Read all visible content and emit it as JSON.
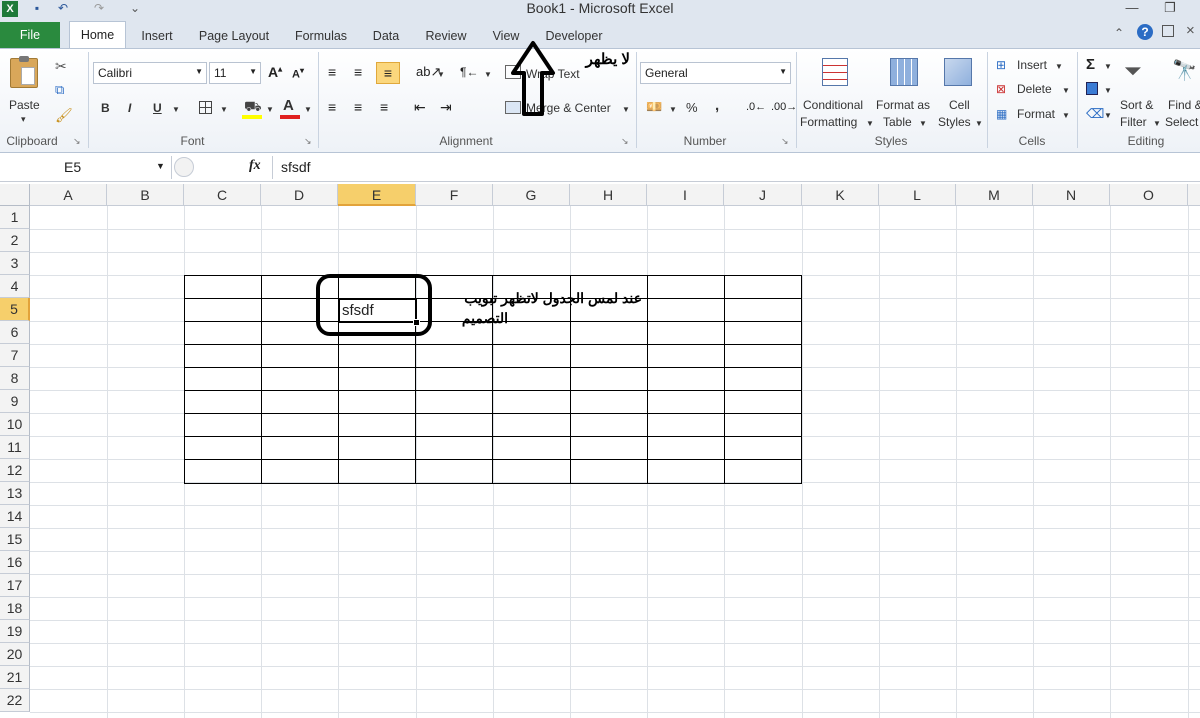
{
  "window": {
    "title": "Book1  -  Microsoft Excel"
  },
  "tabs": [
    "File",
    "Home",
    "Insert",
    "Page Layout",
    "Formulas",
    "Data",
    "Review",
    "View",
    "Developer"
  ],
  "clipboard": {
    "paste": "Paste",
    "group": "Clipboard"
  },
  "font": {
    "name": "Calibri",
    "size": "11",
    "group": "Font",
    "bold": "B",
    "italic": "I",
    "underline": "U"
  },
  "alignment": {
    "wrap_text": "Wrap Text",
    "merge_center": "Merge & Center",
    "group": "Alignment"
  },
  "number": {
    "format": "General",
    "percent": "%",
    "comma": ",",
    "group": "Number"
  },
  "styles": {
    "conditional": [
      "Conditional",
      "Formatting"
    ],
    "format_as_table": [
      "Format as",
      "Table"
    ],
    "cell_styles": [
      "Cell",
      "Styles"
    ],
    "group": "Styles"
  },
  "cells": {
    "insert": "Insert",
    "delete": "Delete",
    "format": "Format",
    "group": "Cells"
  },
  "editing": {
    "sort_filter": [
      "Sort &",
      "Filter"
    ],
    "find_select": [
      "Find &",
      "Select"
    ],
    "group": "Editing"
  },
  "formula_bar": {
    "name_box": "E5",
    "fx": "fx",
    "value": "sfsdf"
  },
  "columns": [
    "A",
    "B",
    "C",
    "D",
    "E",
    "F",
    "G",
    "H",
    "I",
    "J",
    "K",
    "L",
    "M",
    "N",
    "O"
  ],
  "rows": [
    "1",
    "2",
    "3",
    "4",
    "5",
    "6",
    "7",
    "8",
    "9",
    "10",
    "11",
    "12",
    "13",
    "14",
    "15",
    "16",
    "17",
    "18",
    "19",
    "20",
    "21",
    "22"
  ],
  "active_cell": {
    "ref": "E5",
    "value": "sfsdf"
  },
  "annotations": {
    "arrow_note": "لا يظهر",
    "table_note_line1": "عند لمس الجدول لاتظهر تبويب",
    "table_note_line2": "التصميم"
  },
  "colors": {
    "file_tab": "#2a8a3e",
    "ribbon_border": "#b7c4d5",
    "active_col": "#f6cf6b",
    "font_underline": "#e02020",
    "fill_highlight": "#ffff00"
  }
}
